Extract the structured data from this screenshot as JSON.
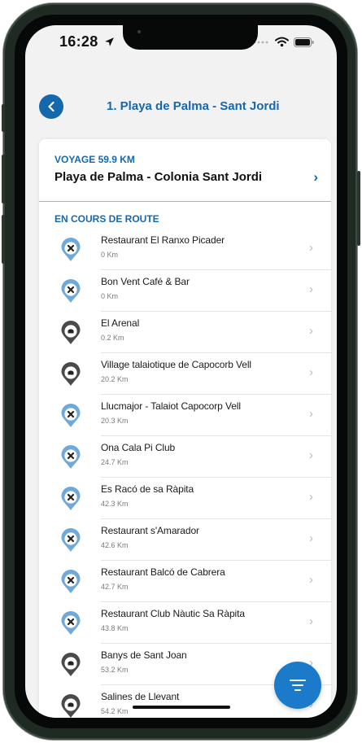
{
  "status_bar": {
    "time": "16:28"
  },
  "header": {
    "title": "1. Playa de Palma - Sant Jordi"
  },
  "voyage": {
    "label": "VOYAGE 59.9 KM",
    "route": "Playa de Palma - Colonia Sant Jordi"
  },
  "section": {
    "label": "EN COURS DE ROUTE"
  },
  "colors": {
    "accent": "#1668ad",
    "restaurant_pin": "#6fa9d9",
    "place_pin": "#4a4a4a",
    "fab": "#1c7acb"
  },
  "stops": [
    {
      "name": "Restaurant El Ranxo Picader",
      "distance": "0 Km",
      "icon": "restaurant-pin-icon"
    },
    {
      "name": "Bon Vent Café & Bar",
      "distance": "0 Km",
      "icon": "restaurant-pin-icon"
    },
    {
      "name": "El Arenal",
      "distance": "0.2 Km",
      "icon": "place-pin-icon"
    },
    {
      "name": "Village talaiotique de Capocorb Vell",
      "distance": "20.2 Km",
      "icon": "place-pin-icon"
    },
    {
      "name": "Llucmajor - Talaiot Capocorp Vell",
      "distance": "20.3 Km",
      "icon": "restaurant-pin-icon"
    },
    {
      "name": "Ona Cala Pi Club",
      "distance": "24.7 Km",
      "icon": "restaurant-pin-icon"
    },
    {
      "name": "Es Racó de sa Ràpita",
      "distance": "42.3 Km",
      "icon": "restaurant-pin-icon"
    },
    {
      "name": "Restaurant s'Amarador",
      "distance": "42.6 Km",
      "icon": "restaurant-pin-icon"
    },
    {
      "name": "Restaurant Balcó de Cabrera",
      "distance": "42.7 Km",
      "icon": "restaurant-pin-icon"
    },
    {
      "name": "Restaurant Club Nàutic Sa Ràpita",
      "distance": "43.8 Km",
      "icon": "restaurant-pin-icon"
    },
    {
      "name": "Banys de Sant Joan",
      "distance": "53.2 Km",
      "icon": "place-pin-icon"
    },
    {
      "name": "Salines de Llevant",
      "distance": "54.2 Km",
      "icon": "place-pin-icon"
    }
  ]
}
